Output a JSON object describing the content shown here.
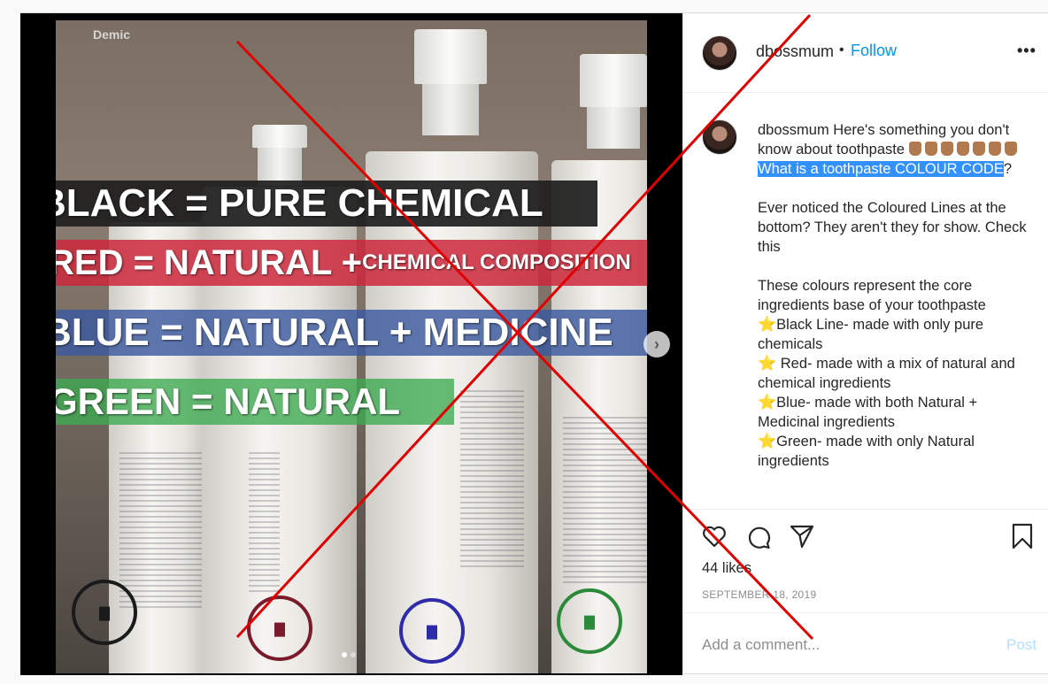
{
  "media": {
    "watermark": "Demic",
    "bands": {
      "black": "BLACK = PURE CHEMICAL",
      "red_main": "RED = NATURAL + ",
      "red_small": "CHEMICAL COMPOSITION",
      "blue": "BLUE = NATURAL + MEDICINE",
      "green": "GREEN = NATURAL"
    },
    "ring_colors": [
      "#1a1a1a",
      "#7a1a2a",
      "#2e2aa8",
      "#2b8a3a"
    ],
    "crossout_color": "#e00000",
    "carousel_count": 2,
    "carousel_active": 0
  },
  "header": {
    "username": "dbossmum",
    "separator": "•",
    "follow_label": "Follow",
    "more_label": "•••"
  },
  "caption": {
    "username": "dbossmum",
    "intro": " Here's something you don't know about toothpaste ",
    "highlight": "What is a toothpaste COLOUR CODE",
    "after_highlight": "?",
    "para2": "Ever noticed the Coloured Lines at the bottom? They aren't they for show. Check this",
    "para3": "These colours represent the core ingredients base of your toothpaste",
    "items": [
      "Black Line- made with only pure chemicals",
      " Red- made with a mix of natural and chemical ingredients",
      "Blue- made with both Natural + Medicinal ingredients",
      "Green- made with only Natural ingredients"
    ],
    "star_glyph": "⭐"
  },
  "stats": {
    "likes": "44 likes",
    "date": "SEPTEMBER 18, 2019"
  },
  "comment": {
    "placeholder": "Add a comment...",
    "post_label": "Post"
  }
}
